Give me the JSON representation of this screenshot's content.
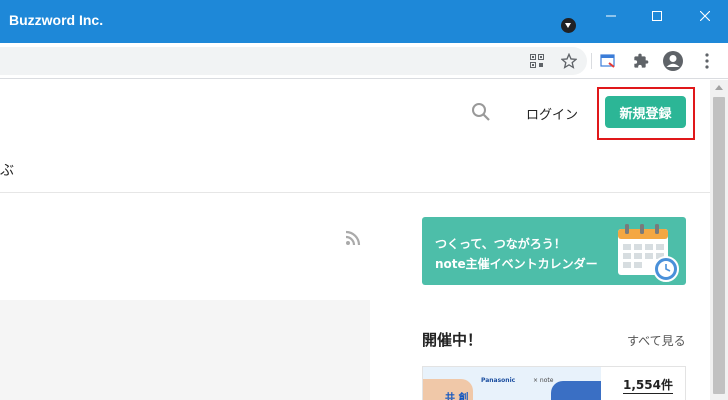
{
  "window": {
    "title": "Buzzword Inc.",
    "controls": {
      "minimize": "minimize-icon",
      "maximize": "maximize-icon",
      "close": "close-icon"
    }
  },
  "toolbar": {
    "icons": [
      "qr-code-icon",
      "star-icon",
      "note-extension-icon",
      "puzzle-icon",
      "profile-icon",
      "more-vert-icon"
    ]
  },
  "header": {
    "search_icon": "search-icon",
    "login_label": "ログイン",
    "signup_label": "新規登録",
    "nav_partial": "ぶ"
  },
  "banner": {
    "line1": "つくって、つながろう！",
    "line2": "note主催イベントカレンダー"
  },
  "events": {
    "section_title": "開催中！",
    "see_all": "すべて見る",
    "thumb_text": {
      "brand1": "Panasonic",
      "brand2": "× note",
      "headline": "共 創"
    },
    "count": "1,554件"
  },
  "colors": {
    "titlebar": "#1e88d8",
    "signup": "#2cb696",
    "highlight": "#e0181a",
    "banner": "#4dbea9"
  }
}
